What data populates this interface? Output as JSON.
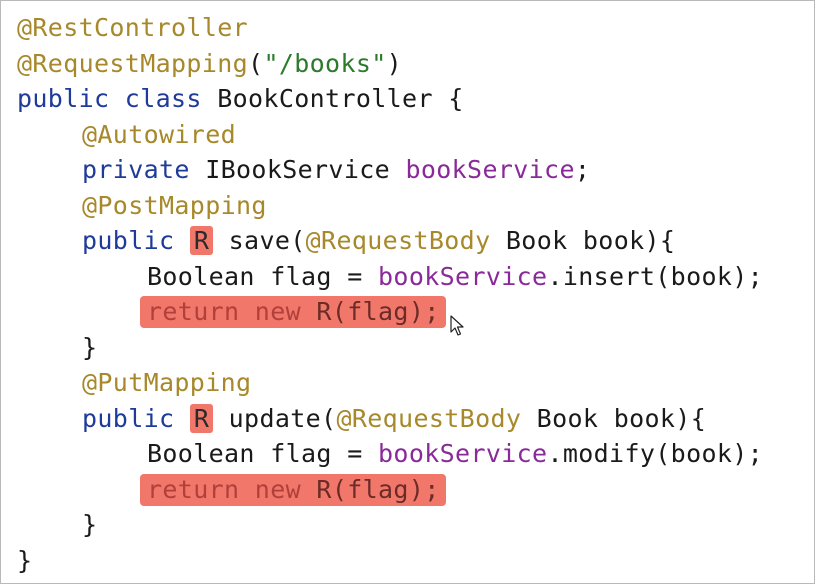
{
  "editor": {
    "lines": {
      "l1_ann": "@RestController",
      "l2_ann": "@RequestMapping",
      "l2_paren_open": "(",
      "l2_string": "\"/books\"",
      "l2_paren_close": ")",
      "l3_kw": "public class",
      "l3_rest": " BookController {",
      "l4_ann": "@Autowired",
      "l5_kw": "private",
      "l5_type": " IBookService ",
      "l5_field": "bookService",
      "l5_end": ";",
      "l6_ann": "@PostMapping",
      "l7_kw": "public",
      "l7_ret": "R",
      "l7_name": "save(",
      "l7_ann": "@RequestBody",
      "l7_rest": " Book book){",
      "l8_type": "Boolean flag = ",
      "l8_field": "bookService",
      "l8_rest": ".insert(book);",
      "l9_kw": "return new",
      "l9_rest": " R(flag);",
      "l10_brace": "}",
      "l11_ann": "@PutMapping",
      "l12_kw": "public",
      "l12_ret": "R",
      "l12_name": "update(",
      "l12_ann": "@RequestBody",
      "l12_rest": " Book book){",
      "l13_type": "Boolean flag = ",
      "l13_field": "bookService",
      "l13_rest": ".modify(book);",
      "l14_kw": "return new",
      "l14_rest": " R(flag);",
      "l15_brace": "}",
      "l16_brace": "}"
    },
    "colors": {
      "annotation": "#a7882a",
      "keyword": "#1f3b9a",
      "string": "#2b7b2b",
      "field": "#8a2a9a",
      "highlight": "#f1776b"
    }
  }
}
